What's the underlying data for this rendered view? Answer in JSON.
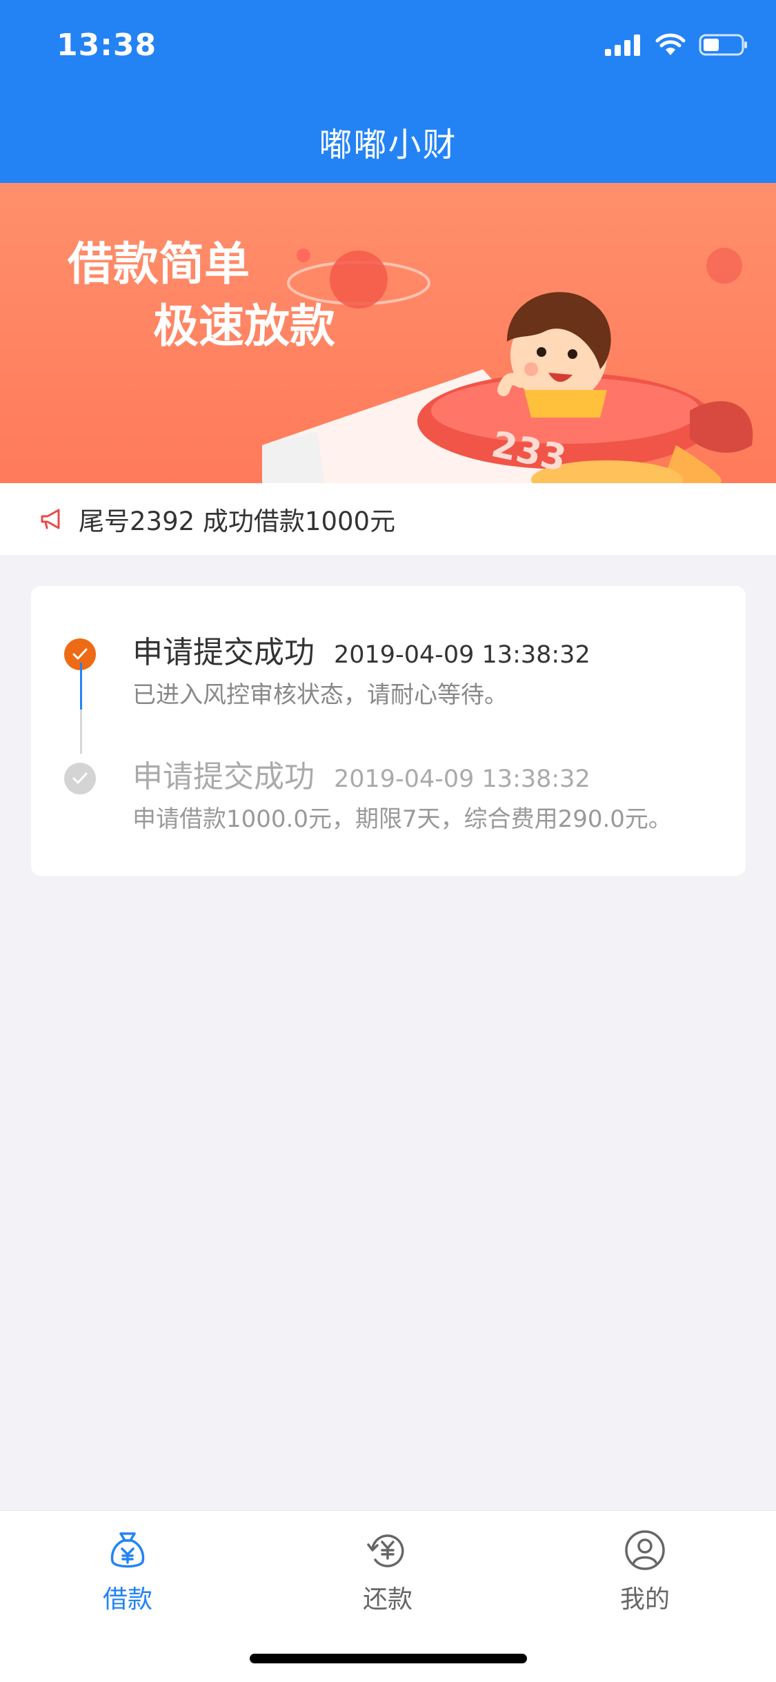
{
  "status_bar": {
    "time": "13:38",
    "icons": [
      "signal-icon",
      "wifi-icon",
      "battery-icon"
    ]
  },
  "nav": {
    "title": "嘟嘟小财"
  },
  "banner": {
    "line1": "借款简单",
    "line2": "极速放款",
    "rocket_number": "233"
  },
  "notice": {
    "icon": "megaphone-icon",
    "text": "尾号2392 成功借款1000元"
  },
  "timeline": [
    {
      "title": "申请提交成功",
      "time": "2019-04-09 13:38:32",
      "desc": "已进入风控审核状态，请耐心等待。",
      "state": "active"
    },
    {
      "title": "申请提交成功",
      "time": "2019-04-09 13:38:32",
      "desc": "申请借款1000.0元，期限7天，综合费用290.0元。",
      "state": "inactive"
    }
  ],
  "tabs": [
    {
      "label": "借款",
      "icon": "loan-bag-icon",
      "active": true
    },
    {
      "label": "还款",
      "icon": "repay-icon",
      "active": false
    },
    {
      "label": "我的",
      "icon": "profile-icon",
      "active": false
    }
  ],
  "colors": {
    "primary": "#2383f5",
    "accent": "#ee6a14",
    "banner": "#ff7f5f"
  }
}
